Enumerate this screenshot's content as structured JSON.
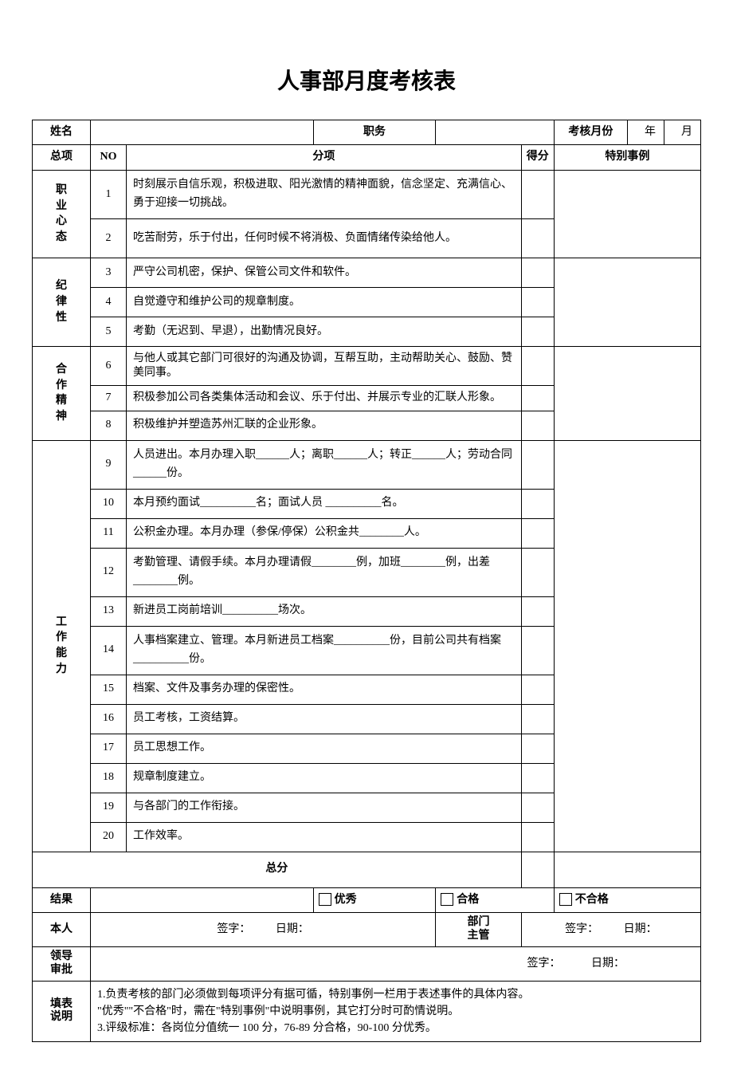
{
  "title": "人事部月度考核表",
  "header": {
    "name_label": "姓名",
    "position_label": "职务",
    "month_label": "考核月份",
    "year_suffix": "年",
    "month_suffix": "月"
  },
  "columns": {
    "category": "总项",
    "no": "NO",
    "item": "分项",
    "score": "得分",
    "special": "特别事例"
  },
  "sections": [
    {
      "name": "职\n业\n心\n态",
      "rows": [
        {
          "no": "1",
          "text": "时刻展示自信乐观，积极进取、阳光激情的精神面貌，信念坚定、充满信心、勇于迎接一切挑战。"
        },
        {
          "no": "2",
          "text": "吃苦耐劳，乐于付出，任何时候不将消极、负面情绪传染给他人。"
        }
      ]
    },
    {
      "name": "纪\n律\n性",
      "rows": [
        {
          "no": "3",
          "text": "严守公司机密，保护、保管公司文件和软件。"
        },
        {
          "no": "4",
          "text": "自觉遵守和维护公司的规章制度。"
        },
        {
          "no": "5",
          "text": "考勤（无迟到、早退），出勤情况良好。"
        }
      ]
    },
    {
      "name": "合\n作\n精\n神",
      "rows": [
        {
          "no": "6",
          "text": "与他人或其它部门可很好的沟通及协调，互帮互助，主动帮助关心、鼓励、赞美同事。"
        },
        {
          "no": "7",
          "text": "积极参加公司各类集体活动和会议、乐于付出、并展示专业的汇联人形象。"
        },
        {
          "no": "8",
          "text": "积极维护并塑造苏州汇联的企业形象。"
        }
      ]
    },
    {
      "name": "工\n作\n能\n力",
      "rows": [
        {
          "no": "9",
          "text": "人员进出。本月办理入职______人；离职______人；转正______人；劳动合同______份。"
        },
        {
          "no": "10",
          "text": "本月预约面试__________名；面试人员 __________名。"
        },
        {
          "no": "11",
          "text": "公积金办理。本月办理（参保/停保）公积金共________人。"
        },
        {
          "no": "12",
          "text": "考勤管理、请假手续。本月办理请假________例，加班________例，出差________例。"
        },
        {
          "no": "13",
          "text": "新进员工岗前培训__________场次。"
        },
        {
          "no": "14",
          "text": "人事档案建立、管理。本月新进员工档案__________份，目前公司共有档案__________份。"
        },
        {
          "no": "15",
          "text": "档案、文件及事务办理的保密性。"
        },
        {
          "no": "16",
          "text": "员工考核，工资结算。"
        },
        {
          "no": "17",
          "text": "员工思想工作。"
        },
        {
          "no": "18",
          "text": "规章制度建立。"
        },
        {
          "no": "19",
          "text": "与各部门的工作衔接。"
        },
        {
          "no": "20",
          "text": "工作效率。"
        }
      ]
    }
  ],
  "total_label": "总分",
  "result": {
    "label": "结果",
    "excellent": "优秀",
    "pass": "合格",
    "fail": "不合格"
  },
  "signatures": {
    "self_label": "本人",
    "dept_label": "部门\n主管",
    "leader_label": "领导\n审批",
    "sign_label": "签字：",
    "date_label": "日期："
  },
  "instructions": {
    "label": "填表\n说明",
    "line1": "1.负责考核的部门必须做到每项评分有据可循，特别事例一栏用于表述事件的具体内容。",
    "line2": "\"优秀\"\"不合格\"时，需在\"特别事例\"中说明事例，其它打分时可酌情说明。",
    "line3": "3.评级标准：各岗位分值统一 100 分，76-89 分合格，90-100 分优秀。"
  }
}
